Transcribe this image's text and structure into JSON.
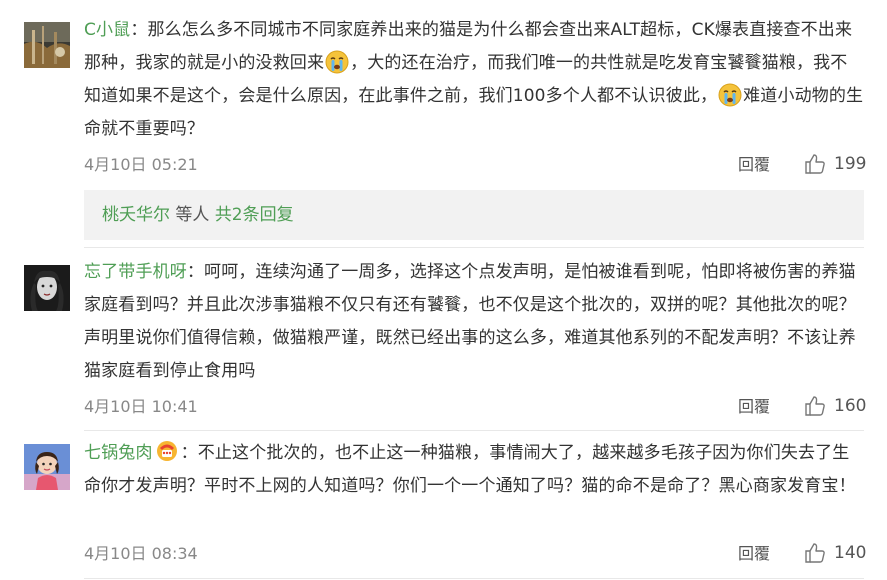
{
  "comments": [
    {
      "user": "C小鼠",
      "text_parts": [
        "：那么怎么多不同城市不同家庭养出来的猫是为什么都会查出来ALT超标，CK爆表直接查不出来那种，我家的就是小的没救回来",
        "，大的还在治疗，而我们唯一的共性就是吃发育宝饕餮猫粮，我不知道如果不是这个，会是什么原因，在此事件之前，我们100多个人都不认识彼此，",
        "难道小动物的生命就不重要吗？"
      ],
      "emoji": "crying-face",
      "time": "4月10日 05:21",
      "reply_label": "回覆",
      "likes": "199",
      "sub_replies": {
        "user": "桃夭华尔",
        "suffix": "等人",
        "total": "共2条回复"
      }
    },
    {
      "user": "忘了带手机呀",
      "text": "：呵呵，连续沟通了一周多，选择这个点发声明，是怕被谁看到呢，怕即将被伤害的养猫家庭看到吗？并且此次涉事猫粮不仅只有还有饕餮，也不仅是这个批次的，双拼的呢？其他批次的呢？声明里说你们值得信赖，做猫粮严谨，既然已经出事的这么多，难道其他系列的不配发声明？不该让养猫家庭看到停止食用吗",
      "time": "4月10日 10:41",
      "reply_label": "回覆",
      "likes": "160"
    },
    {
      "user": "七锅兔肉",
      "text": "：不止这个批次的，也不止这一种猫粮，事情闹大了，越来越多毛孩子因为你们失去了生命你才发声明？平时不上网的人知道吗？你们一个一个通知了吗？猫的命不是命了？黑心商家发育宝！",
      "time": "4月10日 08:34",
      "reply_label": "回覆",
      "likes": "140"
    }
  ],
  "colors": {
    "username": "#4f9e55",
    "meta": "#888888",
    "sub_reply_bg": "#f2f2f2"
  },
  "icons": {
    "like": "thumbs-up-icon",
    "emoji": "crying-face-icon",
    "badge": "fan-badge-icon"
  }
}
